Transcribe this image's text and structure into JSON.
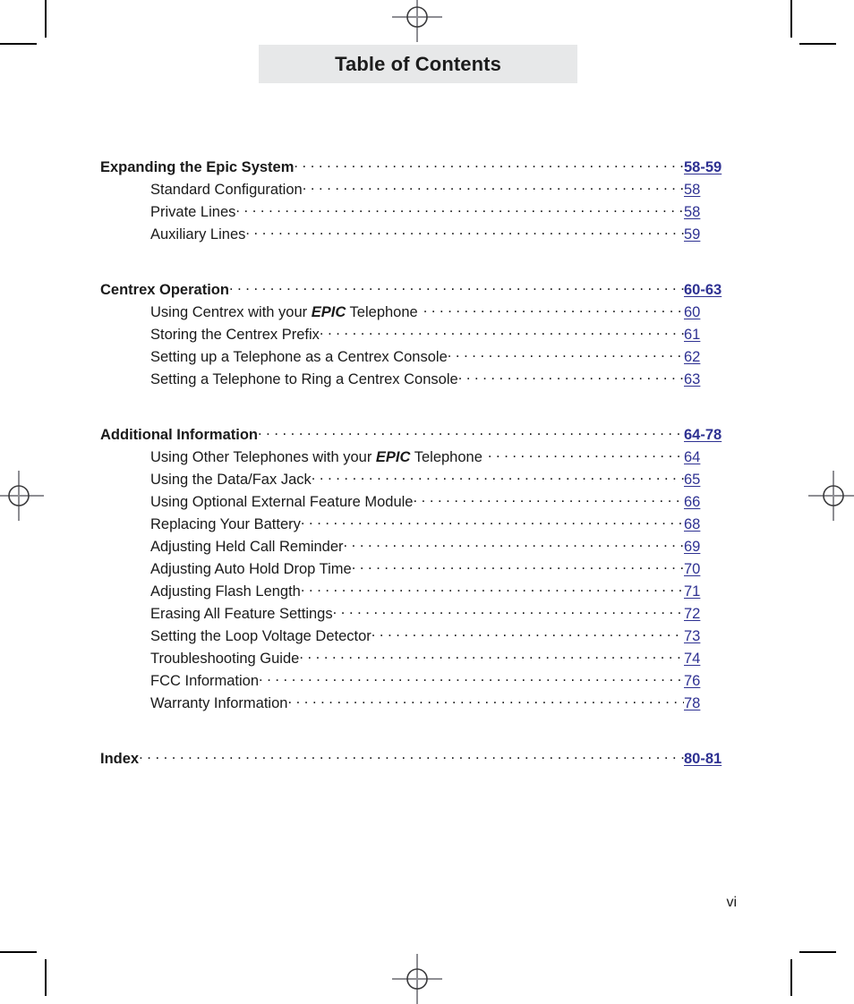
{
  "document": {
    "banner_title": "Table of Contents",
    "folio": "vi",
    "link_color": "#2e3192",
    "banner_bg": "#e7e8e9"
  },
  "marks": {
    "registration_top": "registration-mark",
    "registration_bottom": "registration-mark",
    "registration_left": "registration-mark",
    "registration_right": "registration-mark",
    "crop_top_left": "crop-mark",
    "crop_top_right": "crop-mark",
    "crop_bottom_left": "crop-mark",
    "crop_bottom_right": "crop-mark"
  },
  "toc": {
    "sections": [
      {
        "heading": {
          "label": "Expanding the Epic System",
          "page": "58-59"
        },
        "entries": [
          {
            "label": "Standard Configuration",
            "page": "58"
          },
          {
            "label": "Private Lines",
            "page": "58"
          },
          {
            "label": "Auxiliary Lines",
            "page": "59"
          }
        ]
      },
      {
        "heading": {
          "label": "Centrex Operation",
          "page": "60-63"
        },
        "entries": [
          {
            "label_pre": "Using Centrex with your ",
            "emphasis": "EPIC",
            "label_post": " Telephone",
            "page": "60"
          },
          {
            "label": "Storing the Centrex Prefix",
            "page": "61"
          },
          {
            "label": "Setting up a Telephone as a Centrex Console",
            "page": "62"
          },
          {
            "label": "Setting a Telephone to Ring a Centrex Console",
            "page": "63"
          }
        ]
      },
      {
        "heading": {
          "label": "Additional Information",
          "page": "64-78"
        },
        "entries": [
          {
            "label_pre": "Using Other Telephones with your ",
            "emphasis": "EPIC",
            "label_post": " Telephone",
            "page": "64"
          },
          {
            "label": "Using the Data/Fax Jack",
            "page": "65"
          },
          {
            "label": "Using Optional External Feature Module",
            "page": "66"
          },
          {
            "label": "Replacing Your Battery",
            "page": "68"
          },
          {
            "label": "Adjusting Held Call Reminder",
            "page": "69"
          },
          {
            "label": "Adjusting Auto Hold Drop Time",
            "page": "70"
          },
          {
            "label": "Adjusting Flash Length",
            "page": "71"
          },
          {
            "label": "Erasing All Feature Settings",
            "page": "72"
          },
          {
            "label": "Setting the Loop Voltage Detector",
            "page": "73"
          },
          {
            "label": "Troubleshooting Guide",
            "page": "74"
          },
          {
            "label": "FCC Information",
            "page": "76"
          },
          {
            "label": "Warranty Information",
            "page": "78"
          }
        ]
      },
      {
        "heading": {
          "label": "Index",
          "page": "80-81"
        },
        "entries": []
      }
    ]
  }
}
